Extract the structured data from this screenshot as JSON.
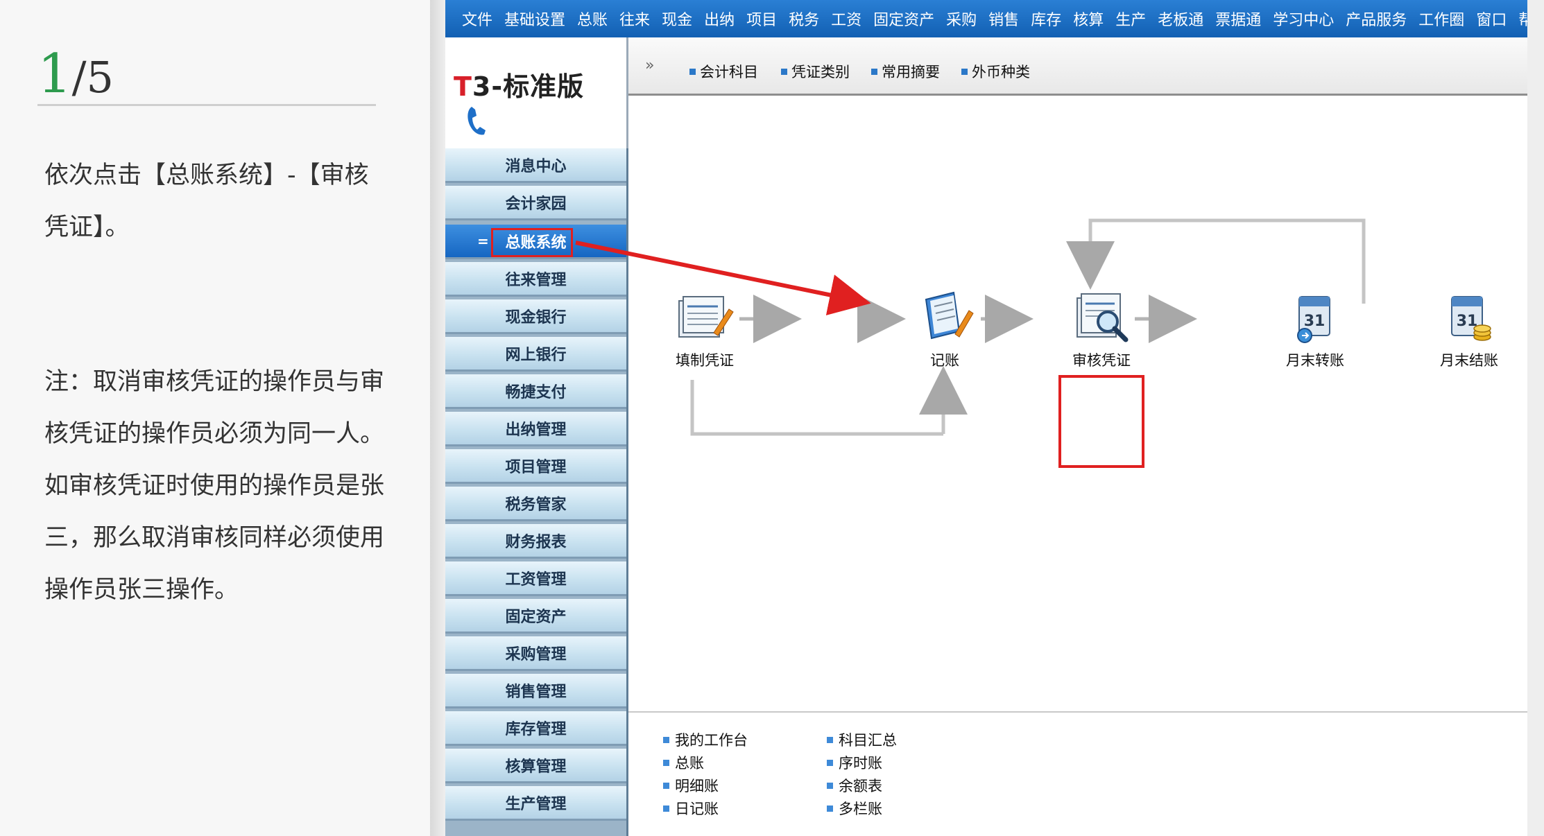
{
  "tutorial": {
    "step_current": "1",
    "step_separator": "/",
    "step_total": "5",
    "instruction": "依次点击【总账系统】-【审核凭证】。",
    "note": "注：取消审核凭证的操作员与审核凭证的操作员必须为同一人。如审核凭证时使用的操作员是张三，那么取消审核同样必须使用操作员张三操作。"
  },
  "menubar": {
    "items": [
      "文件",
      "基础设置",
      "总账",
      "往来",
      "现金",
      "出纳",
      "项目",
      "税务",
      "工资",
      "固定资产",
      "采购",
      "销售",
      "库存",
      "核算",
      "生产",
      "老板通",
      "票据通",
      "学习中心",
      "产品服务",
      "工作圈",
      "窗口",
      "帮助"
    ]
  },
  "logo": {
    "prefix": "T",
    "text": "3-标准版"
  },
  "toolbar": {
    "chevron": "»",
    "items": [
      "会计科目",
      "凭证类别",
      "常用摘要",
      "外币种类"
    ]
  },
  "sidebar": {
    "items": [
      "消息中心",
      "会计家园",
      "总账系统",
      "往来管理",
      "现金银行",
      "网上银行",
      "畅捷支付",
      "出纳管理",
      "项目管理",
      "税务管家",
      "财务报表",
      "工资管理",
      "固定资产",
      "采购管理",
      "销售管理",
      "库存管理",
      "核算管理",
      "生产管理"
    ],
    "active_index": 2,
    "active_marker": "="
  },
  "workflow": {
    "nodes": [
      {
        "label": "填制凭证",
        "icon": "voucher-entry-icon"
      },
      {
        "label": "审核凭证",
        "icon": "voucher-audit-icon"
      },
      {
        "label": "记账",
        "icon": "posting-icon"
      },
      {
        "label": "月末转账",
        "icon": "month-end-transfer-icon"
      },
      {
        "label": "月末结账",
        "icon": "month-end-closing-icon"
      }
    ],
    "highlighted_node": "审核凭证"
  },
  "bottom_links": {
    "left": [
      "我的工作台",
      "总账",
      "明细账",
      "日记账"
    ],
    "right": [
      "科目汇总",
      "序时账",
      "余额表",
      "多栏账"
    ]
  },
  "colors": {
    "menubar": "#1a6cc4",
    "highlight": "#e02020",
    "step_current": "#2e9b4e",
    "sidebar_active": "#1666c2"
  }
}
